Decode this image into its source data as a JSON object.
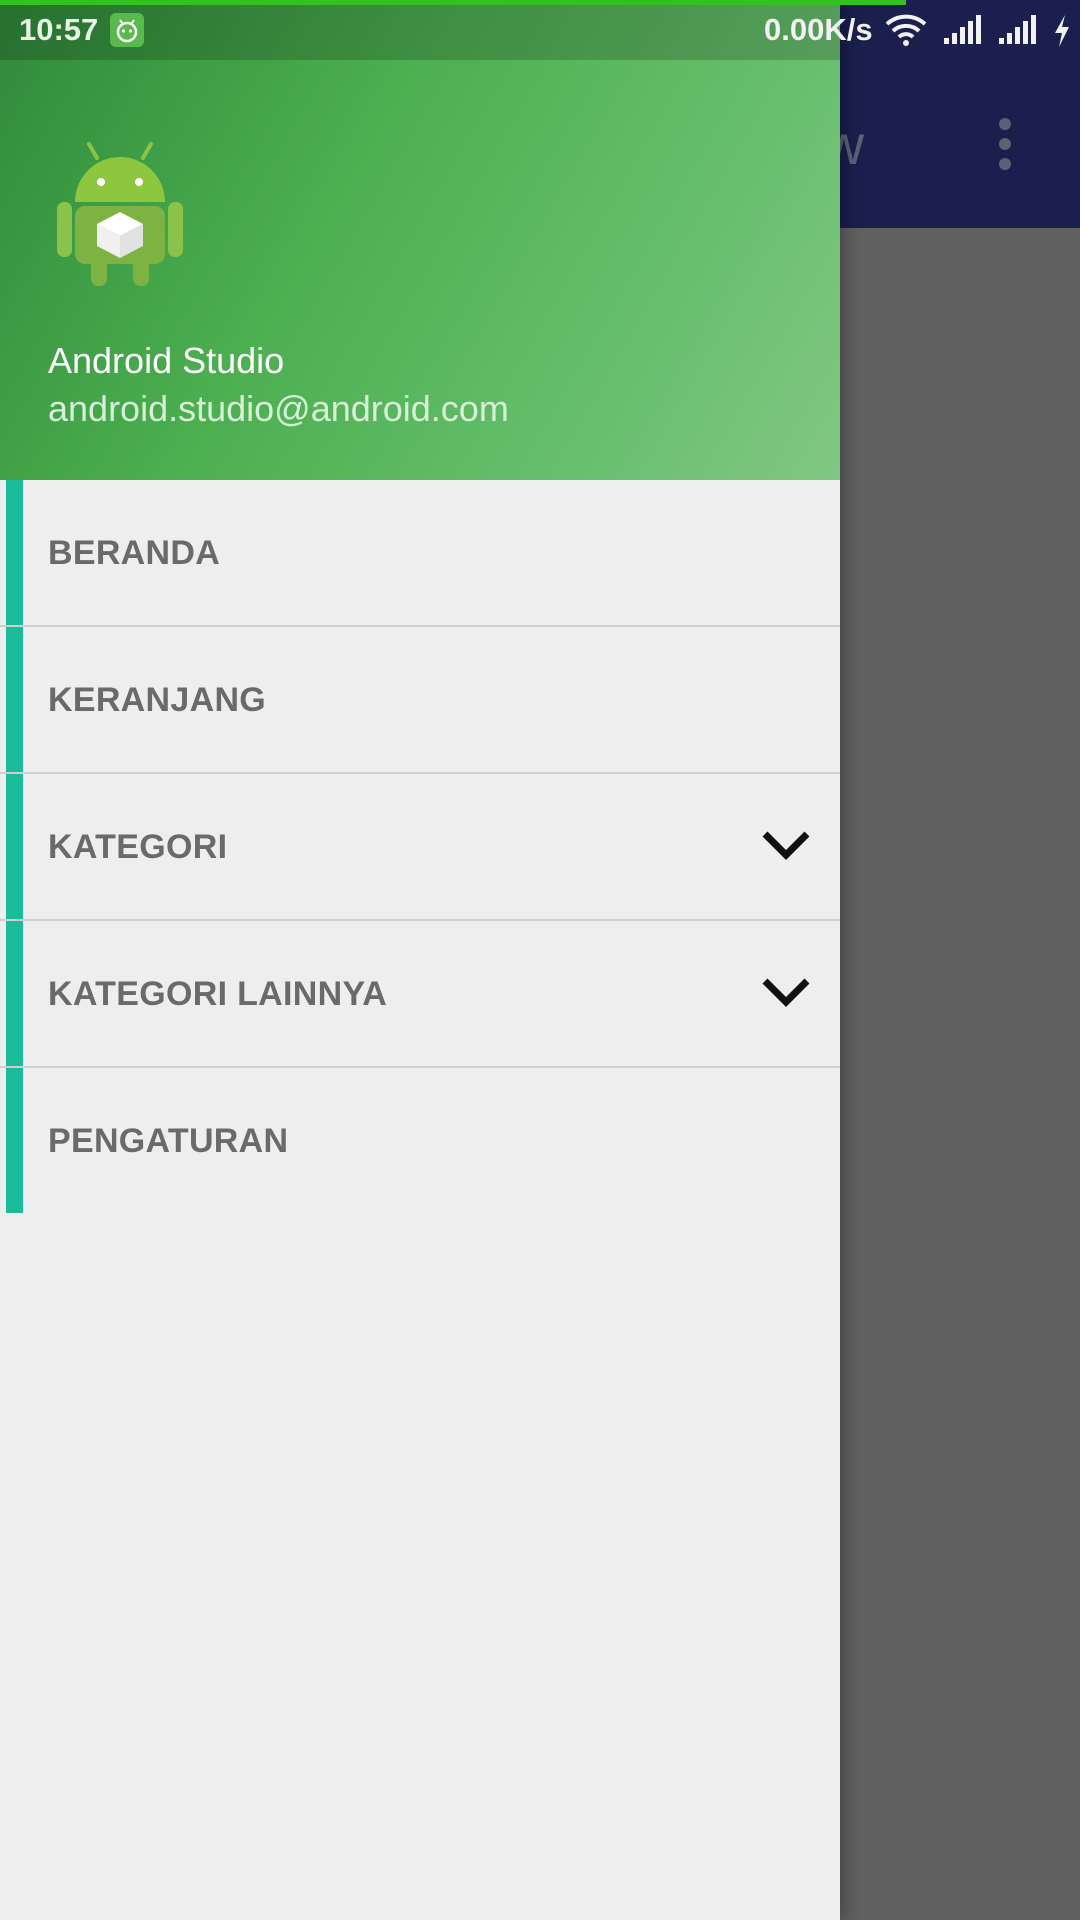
{
  "status_bar": {
    "time": "10:57",
    "network_speed": "0.00K/s",
    "icons": [
      "notification-app-icon",
      "wifi-icon",
      "signal-icon",
      "signal-icon",
      "charging-icon"
    ]
  },
  "background_app": {
    "toolbar_title": "iew",
    "toolbar_color": "#1a1f4e",
    "overflow_icon": "more-vert-icon"
  },
  "drawer": {
    "header": {
      "avatar_icon": "android-robot-icon",
      "user_name": "Android Studio",
      "user_email": "android.studio@android.com",
      "gradient_colors": [
        "#2f8a3a",
        "#4caf50",
        "#81c784"
      ]
    },
    "accent_color": "#1abc9c",
    "menu": [
      {
        "label": "BERANDA",
        "expandable": false
      },
      {
        "label": "KERANJANG",
        "expandable": false
      },
      {
        "label": "KATEGORI",
        "expandable": true,
        "icon": "chevron-down-icon"
      },
      {
        "label": "KATEGORI LAINNYA",
        "expandable": true,
        "icon": "chevron-down-icon"
      },
      {
        "label": "PENGATURAN",
        "expandable": false
      }
    ]
  }
}
